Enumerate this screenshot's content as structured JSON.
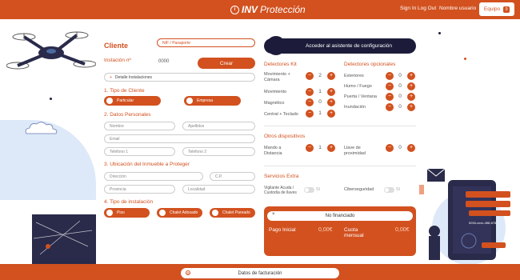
{
  "header": {
    "brand": "INV",
    "subtitle": "Protección",
    "nav": [
      "Sign In",
      "Log Out",
      "Nombre usuario"
    ],
    "team_label": "Equipo",
    "team_count": "0"
  },
  "form": {
    "cliente_label": "Cliente",
    "nif_placeholder": "NIF / Pasaporte",
    "instalacion_label": "Instación nº",
    "instalacion_value": "0000",
    "crear_label": "Crear",
    "detalle_label": "Detalle Instalaciones",
    "tipo_cliente_title": "1. Tipo de Cliente",
    "tipo_cliente_options": [
      "Particular",
      "Empresa"
    ],
    "datos_title": "2. Datos Personales",
    "nombre_ph": "Nombre",
    "apellidos_ph": "Apellidos",
    "email_ph": "Email",
    "tel1_ph": "Teléfono 1",
    "tel2_ph": "Teléfono 2",
    "ubicacion_title": "3. Ubicación del Inmueble a Proteger",
    "direccion_ph": "Dirección",
    "cp_ph": "C.P.",
    "provincia_ph": "Provincia",
    "localidad_ph": "Localidad",
    "tipo_inst_title": "4. Tipo de instalación",
    "tipo_inst_options": [
      "Piso",
      "Chalet Adosado",
      "Chalet Pareado"
    ]
  },
  "assistant": {
    "label": "Acceder al asistente de configuración"
  },
  "kit": {
    "title": "Detectores Kit",
    "items": [
      {
        "label": "Movimiento + Cámara",
        "value": "2"
      },
      {
        "label": "Movimiento",
        "value": "1"
      },
      {
        "label": "Magnético",
        "value": "0"
      },
      {
        "label": "Central + Teclado",
        "value": "1"
      }
    ]
  },
  "optional": {
    "title": "Detectores opcionales",
    "items": [
      {
        "label": "Exteriores",
        "value": "0"
      },
      {
        "label": "Humo / Fuego",
        "value": "0"
      },
      {
        "label": "Puerta / Ventana",
        "value": "0"
      },
      {
        "label": "Inundación",
        "value": "0"
      }
    ]
  },
  "otros": {
    "title": "Otros dispositivos",
    "items": [
      {
        "label": "Mando a Distancia",
        "value": "1"
      },
      {
        "label": "Llave de proximidad",
        "value": "0"
      }
    ]
  },
  "extra": {
    "title": "Servicios Extra",
    "items": [
      {
        "label": "Vigilante Acuda / Custodia de llaves",
        "toggle": "Sí"
      },
      {
        "label": "Ciberseguridad",
        "toggle": "Sí"
      }
    ]
  },
  "finance": {
    "select": "No financiado",
    "pago_label": "Pago Inicial",
    "pago_amount": "0,00€",
    "cuota_label": "Cuota mensual",
    "cuota_amount": "0,00€"
  },
  "phone_number": "0034-xxxx-456-678",
  "footer": {
    "billing_label": "Datos de facturación"
  },
  "colors": {
    "accent": "#d2511f",
    "dark": "#1c1c3a"
  }
}
